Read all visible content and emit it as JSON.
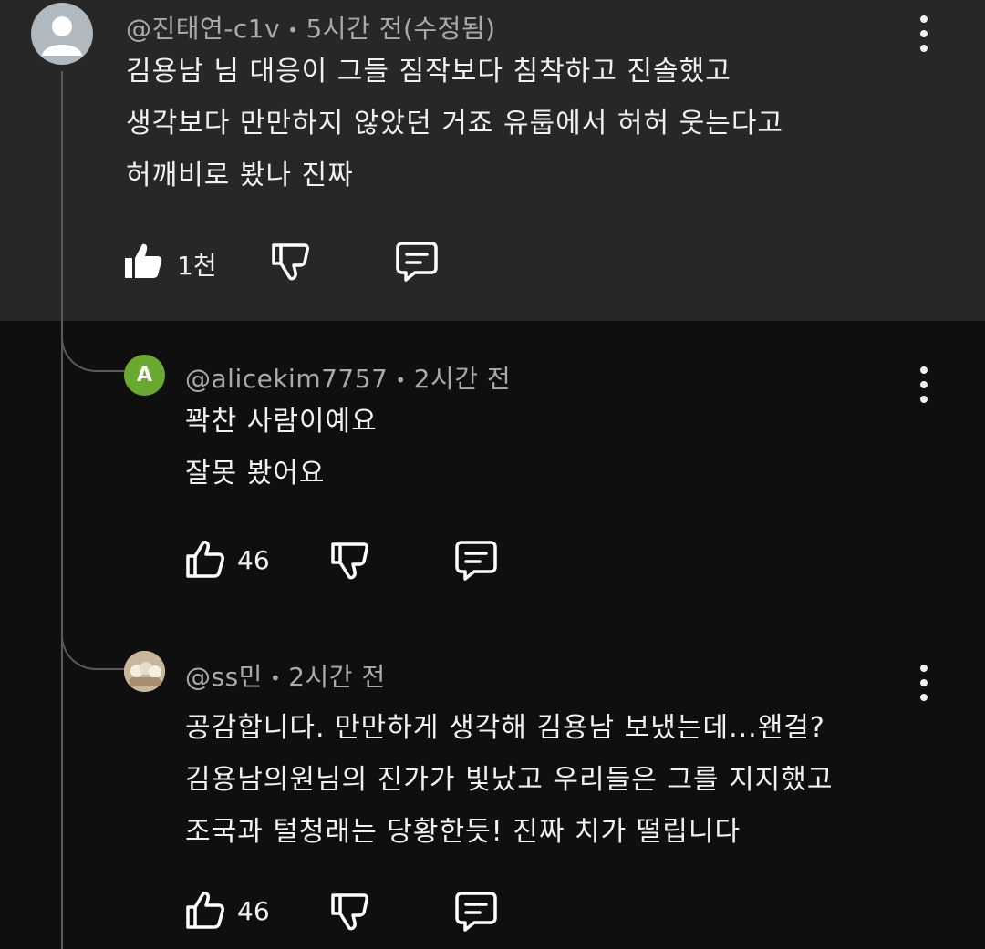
{
  "top_comment": {
    "author": "@진태연-c1v",
    "time": "5시간 전(수정됨)",
    "lines": [
      "김용남 님 대응이 그들 짐작보다 침착하고 진솔했고",
      "생각보다 만만하지 않았던 거죠 유툽에서 허허 웃는다고",
      "허깨비로 봤나 진짜"
    ],
    "like_count": "1천",
    "liked": true
  },
  "replies": [
    {
      "author": "@alicekim7757",
      "time": "2시간 전",
      "avatar_letter": "A",
      "avatar_color": "#6aa92f",
      "lines": [
        "꽉찬 사람이예요",
        "잘못 봤어요"
      ],
      "like_count": "46"
    },
    {
      "author": "@ss민",
      "time": "2시간 전",
      "lines": [
        "공감합니다. 만만하게 생각해 김용남 보냈는데...왠걸?",
        "김용남의원님의 진가가 빛났고 우리들은 그를 지지했고",
        "조국과 털청래는 당황한듯! 진짜 치가 떨립니다"
      ],
      "like_count": "46"
    }
  ],
  "icons": {
    "like": "thumbs-up-icon",
    "dislike": "thumbs-down-icon",
    "reply": "reply-comment-icon",
    "menu": "more-vert-icon"
  },
  "colors": {
    "background": "#0f0f0f",
    "highlight": "#272727",
    "secondary_text": "#aaaaaa"
  }
}
